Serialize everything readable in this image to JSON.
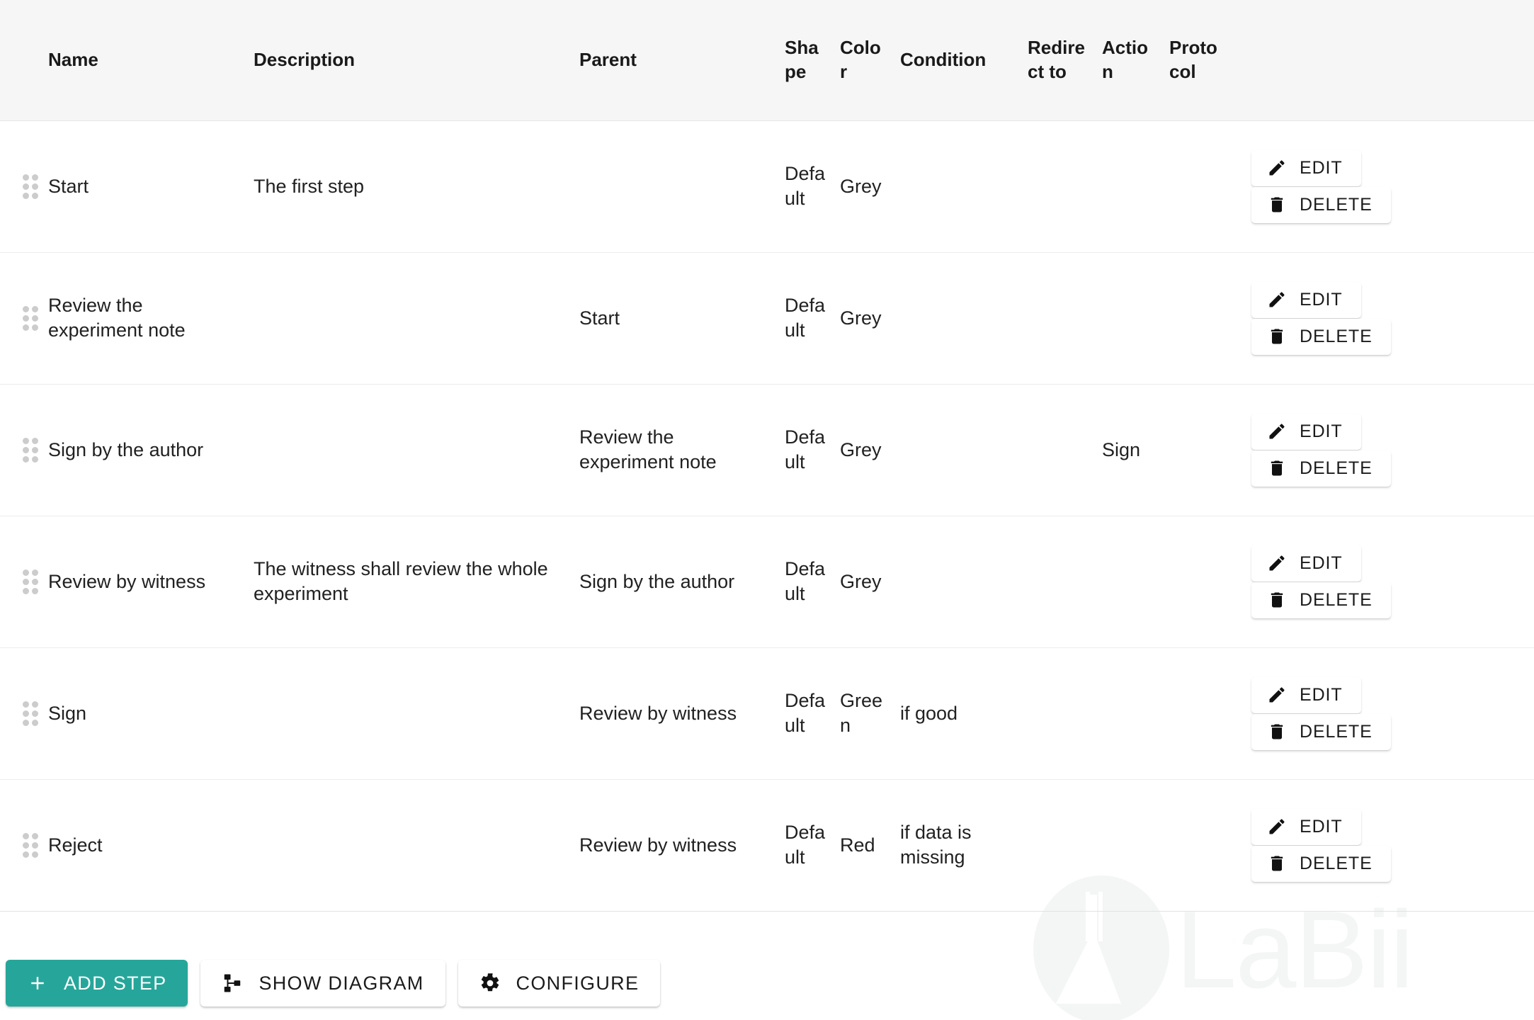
{
  "table": {
    "columns": [
      {
        "key": "handle",
        "label": ""
      },
      {
        "key": "name",
        "label": "Name"
      },
      {
        "key": "desc",
        "label": "Description"
      },
      {
        "key": "parent",
        "label": "Parent"
      },
      {
        "key": "shape",
        "label": "Shape"
      },
      {
        "key": "color",
        "label": "Color"
      },
      {
        "key": "cond",
        "label": "Condition"
      },
      {
        "key": "redir",
        "label": "Redirect to"
      },
      {
        "key": "action",
        "label": "Action"
      },
      {
        "key": "proto",
        "label": "Protocol"
      },
      {
        "key": "buttons",
        "label": ""
      }
    ],
    "headers": {
      "name": "Name",
      "description": "Description",
      "parent": "Parent",
      "shape": "Shape",
      "color": "Color",
      "condition": "Condition",
      "redirect_to": "Redirect to",
      "action": "Action",
      "protocol": "Protocol"
    },
    "rows": [
      {
        "name": "Start",
        "description": "The first step",
        "parent": "",
        "shape": "Default",
        "color": "Grey",
        "condition": "",
        "redirect_to": "",
        "action": "",
        "protocol": ""
      },
      {
        "name": "Review the experiment note",
        "description": "",
        "parent": "Start",
        "shape": "Default",
        "color": "Grey",
        "condition": "",
        "redirect_to": "",
        "action": "",
        "protocol": ""
      },
      {
        "name": "Sign by the author",
        "description": "",
        "parent": "Review the experiment note",
        "shape": "Default",
        "color": "Grey",
        "condition": "",
        "redirect_to": "",
        "action": "Sign",
        "protocol": ""
      },
      {
        "name": "Review by witness",
        "description": "The witness shall review the whole experiment",
        "parent": "Sign by the author",
        "shape": "Default",
        "color": "Grey",
        "condition": "",
        "redirect_to": "",
        "action": "",
        "protocol": ""
      },
      {
        "name": "Sign",
        "description": "",
        "parent": "Review by witness",
        "shape": "Default",
        "color": "Green",
        "condition": "if good",
        "redirect_to": "",
        "action": "",
        "protocol": ""
      },
      {
        "name": "Reject",
        "description": "",
        "parent": "Review by witness",
        "shape": "Default",
        "color": "Red",
        "condition": "if data is missing",
        "redirect_to": "",
        "action": "",
        "protocol": ""
      }
    ],
    "row_actions": {
      "edit_label": "EDIT",
      "delete_label": "DELETE"
    }
  },
  "footer": {
    "add_step_label": "ADD STEP",
    "show_diagram_label": "SHOW DIAGRAM",
    "configure_label": "CONFIGURE"
  },
  "watermark": {
    "text": "LaBii"
  },
  "colors": {
    "accent": "#26a69a",
    "header_bg": "#f6f6f6",
    "text": "#212121",
    "handle_dot": "#cccccc",
    "row_divider": "#ececec",
    "watermark": "#f4f5f5"
  }
}
